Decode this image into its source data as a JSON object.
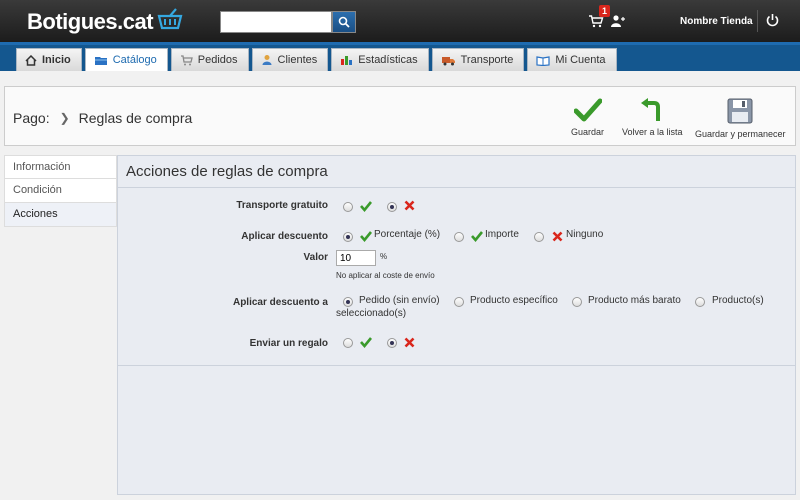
{
  "header": {
    "logo_text": "Botigues.cat",
    "search_value": "",
    "cart_count": "1",
    "store_name": "Nombre Tienda"
  },
  "nav": {
    "tabs": [
      {
        "label": "Inicio",
        "icon": "home-icon"
      },
      {
        "label": "Catálogo",
        "icon": "catalog-icon"
      },
      {
        "label": "Pedidos",
        "icon": "orders-icon"
      },
      {
        "label": "Clientes",
        "icon": "customers-icon"
      },
      {
        "label": "Estadísticas",
        "icon": "stats-icon"
      },
      {
        "label": "Transporte",
        "icon": "truck-icon"
      },
      {
        "label": "Mi Cuenta",
        "icon": "account-icon"
      }
    ],
    "active": "Catálogo"
  },
  "breadcrumb": {
    "parent": "Pago:",
    "current": "Reglas de compra"
  },
  "toolbar": {
    "save": "Guardar",
    "back": "Volver a la lista",
    "save_stay": "Guardar y permanecer"
  },
  "side": {
    "items": [
      "Información",
      "Condición",
      "Acciones"
    ],
    "active": "Acciones"
  },
  "form": {
    "title": "Acciones de reglas de compra",
    "free_shipping": {
      "label": "Transporte gratuito",
      "selected": "no"
    },
    "apply_discount": {
      "label": "Aplicar descuento",
      "options": [
        "Porcentaje (%)",
        "Importe",
        "Ninguno"
      ],
      "selected": "Porcentaje (%)"
    },
    "value": {
      "label": "Valor",
      "value": "10",
      "unit": "%",
      "note": "No aplicar al coste de envío"
    },
    "apply_to": {
      "label": "Aplicar descuento a",
      "options": [
        "Pedido (sin envío)",
        "Producto específico",
        "Producto más barato",
        "Producto(s)"
      ],
      "wrap": "seleccionado(s)",
      "selected": "Pedido (sin envío)"
    },
    "gift": {
      "label": "Enviar un regalo",
      "selected": "no"
    }
  },
  "colors": {
    "header_bg": "#1c1c1c",
    "nav_bg": "#14578f",
    "accent": "#1e6bb0",
    "check_green": "#3a9a2b",
    "cross_red": "#d9261c"
  }
}
